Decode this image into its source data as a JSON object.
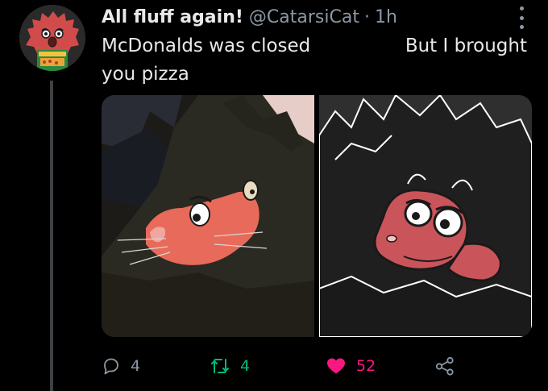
{
  "tweet": {
    "display_name": "All fluff again!",
    "handle": "@CatarsiCat",
    "separator": "·",
    "time": "1h",
    "text_line1_left": "McDonalds was closed",
    "text_line1_right": "But I brought",
    "text_line2": "you pizza"
  },
  "actions": {
    "replies": "4",
    "retweets": "4",
    "likes": "52"
  },
  "colors": {
    "background": "#000000",
    "text": "#e7e9ea",
    "secondary": "#8b98a5",
    "retweet_active": "#00ba7c",
    "like_active": "#f91880"
  },
  "icons": {
    "reply": "reply-icon",
    "retweet": "retweet-icon",
    "like": "heart-icon",
    "share": "share-icon",
    "more": "more-icon"
  }
}
